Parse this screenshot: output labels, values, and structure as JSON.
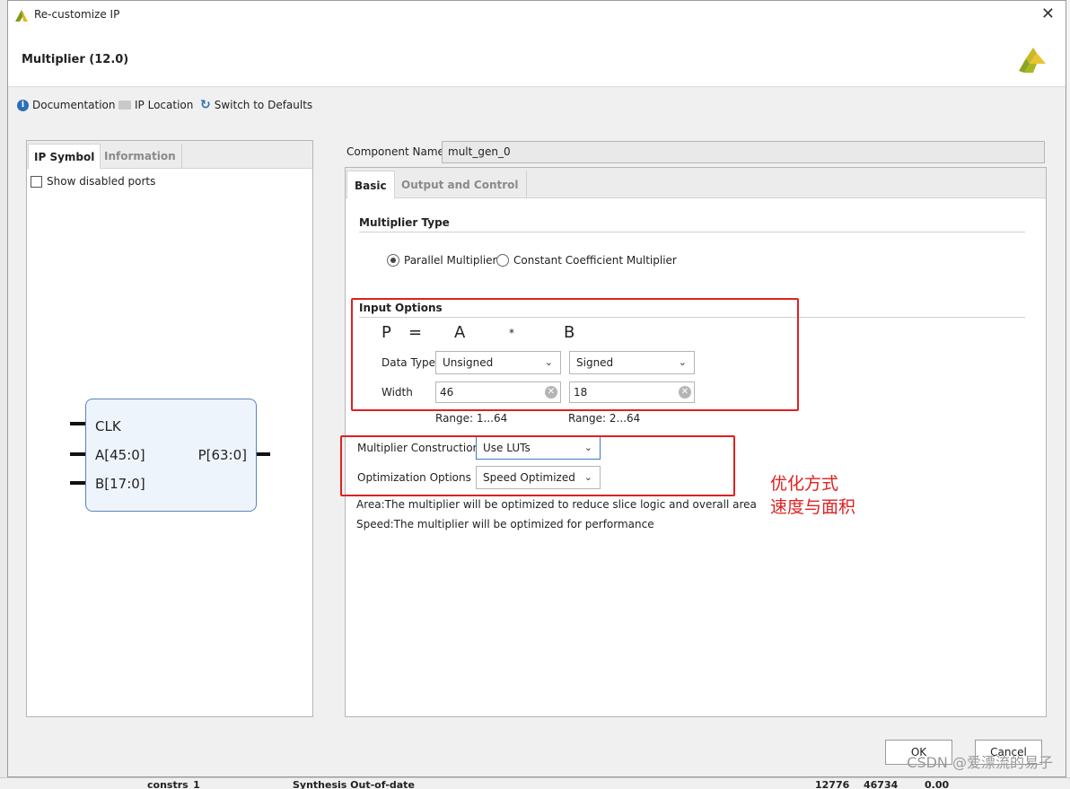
{
  "window": {
    "title": "Re-customize IP",
    "close_glyph": "✕"
  },
  "header": {
    "ip_title": "Multiplier (12.0)"
  },
  "toolbar": {
    "documentation": "Documentation",
    "ip_location": "IP Location",
    "switch_defaults": "Switch to Defaults"
  },
  "left_tabs": {
    "ip_symbol": "IP Symbol",
    "information": "Information"
  },
  "show_disabled_ports": "Show disabled ports",
  "symbol": {
    "clk": "CLK",
    "a": "A[45:0]",
    "b": "B[17:0]",
    "p": "P[63:0]"
  },
  "component": {
    "label": "Component Name",
    "value": "mult_gen_0"
  },
  "right_tabs": {
    "basic": "Basic",
    "output_control": "Output and Control"
  },
  "multiplier_type": {
    "title": "Multiplier Type",
    "parallel": "Parallel Multiplier",
    "constant": "Constant Coefficient Multiplier"
  },
  "input_options": {
    "title": "Input Options",
    "p": "P",
    "eq": "=",
    "a": "A",
    "star": "*",
    "b": "B",
    "data_type_label": "Data Type",
    "a_type": "Unsigned",
    "b_type": "Signed",
    "width_label": "Width",
    "a_width": "46",
    "b_width": "18",
    "a_range": "Range: 1...64",
    "b_range": "Range: 2...64"
  },
  "construction": {
    "label": "Multiplier Construction",
    "value": "Use LUTs",
    "opt_label": "Optimization Options",
    "opt_value": "Speed Optimized"
  },
  "annotation": {
    "line1": "优化方式",
    "line2": "速度与面积"
  },
  "descriptions": {
    "area": "Area:The multiplier will be optimized to reduce slice logic and overall area",
    "speed": "Speed:The multiplier will be optimized for performance"
  },
  "buttons": {
    "ok": "OK",
    "cancel": "Cancel"
  },
  "background": {
    "constrs": "constrs_1",
    "synthesis": "Synthesis Out-of-date",
    "n1": "12776",
    "n2": "46734",
    "n3": "0.00"
  },
  "watermark": "CSDN @爱漂流的易子",
  "colors": {
    "accent": "#2d6fb5",
    "annotation": "#e02020",
    "symbol_fill": "#eef4fc"
  }
}
